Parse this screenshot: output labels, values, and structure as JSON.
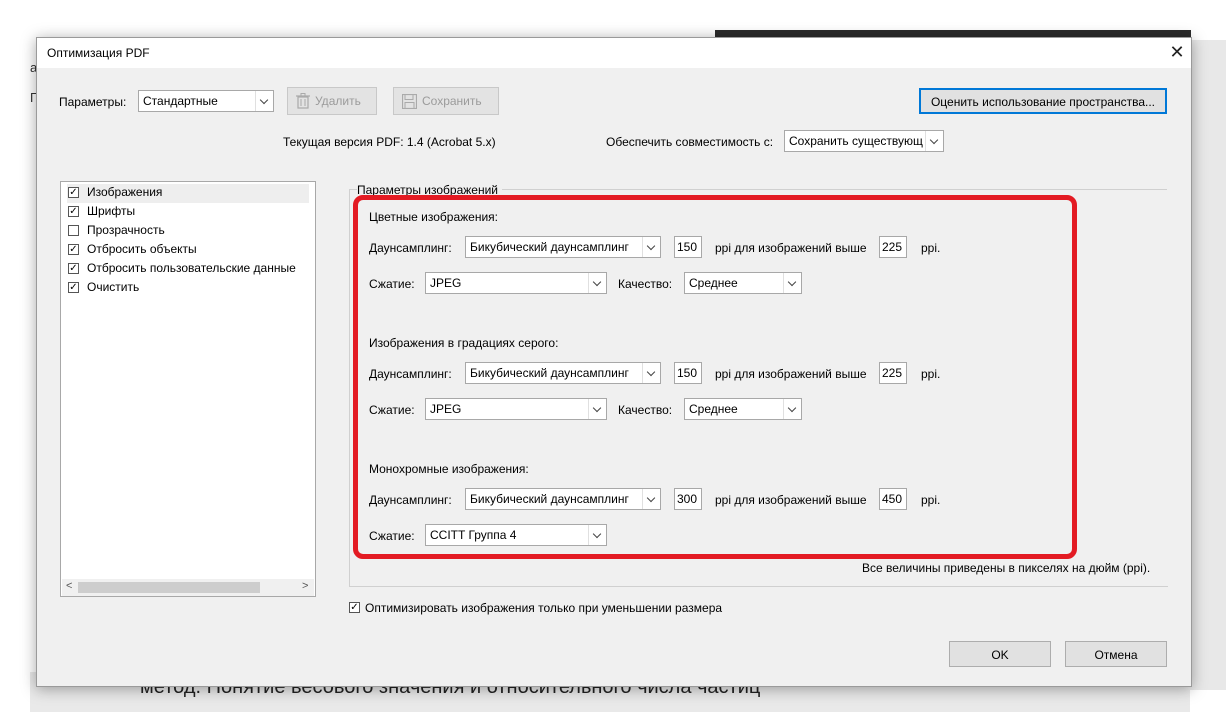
{
  "background": {
    "left_chars": [
      "а",
      "П"
    ],
    "bottom_text": "метод. Понятие весового значения и относительного числа частиц"
  },
  "dialog": {
    "title": "Оптимизация PDF",
    "close_symbol": "✕",
    "params_label": "Параметры:",
    "preset_value": "Стандартные",
    "delete_label": "Удалить",
    "save_label": "Сохранить",
    "audit_button": "Оценить использование пространства...",
    "current_version": "Текущая версия PDF: 1.4 (Acrobat 5.x)",
    "compat_label": "Обеспечить совместимость с:",
    "compat_value": "Сохранить существующ",
    "panels": [
      {
        "label": "Изображения",
        "checked": true,
        "selected": true
      },
      {
        "label": "Шрифты",
        "checked": true
      },
      {
        "label": "Прозрачность",
        "checked": false
      },
      {
        "label": "Отбросить объекты",
        "checked": true
      },
      {
        "label": "Отбросить пользовательские данные",
        "checked": true
      },
      {
        "label": "Очистить",
        "checked": true
      }
    ],
    "group_title": "Параметры изображений",
    "color": {
      "title": "Цветные изображения:",
      "downsample_label": "Даунсамплинг:",
      "downsample_value": "Бикубический даунсамплинг",
      "ppi": "150",
      "above_label": "ppi для изображений выше",
      "above_ppi": "225",
      "ppi_unit": "ppi.",
      "compression_label": "Сжатие:",
      "compression_value": "JPEG",
      "quality_label": "Качество:",
      "quality_value": "Среднее"
    },
    "gray": {
      "title": "Изображения в градациях серого:",
      "downsample_label": "Даунсамплинг:",
      "downsample_value": "Бикубический даунсамплинг",
      "ppi": "150",
      "above_label": "ppi для изображений выше",
      "above_ppi": "225",
      "ppi_unit": "ppi.",
      "compression_label": "Сжатие:",
      "compression_value": "JPEG",
      "quality_label": "Качество:",
      "quality_value": "Среднее"
    },
    "mono": {
      "title": "Монохромные изображения:",
      "downsample_label": "Даунсамплинг:",
      "downsample_value": "Бикубический даунсамплинг",
      "ppi": "300",
      "above_label": "ppi для изображений выше",
      "above_ppi": "450",
      "ppi_unit": "ppi.",
      "compression_label": "Сжатие:",
      "compression_value": "CCITT Группа 4"
    },
    "note": "Все величины приведены в пикселях на дюйм (ppi).",
    "optimize_check": "Оптимизировать изображения только при уменьшении размера",
    "optimize_checked": true,
    "ok_label": "OK",
    "cancel_label": "Отмена",
    "accent_color": "#0078d7",
    "highlight_color": "#e31b23"
  }
}
